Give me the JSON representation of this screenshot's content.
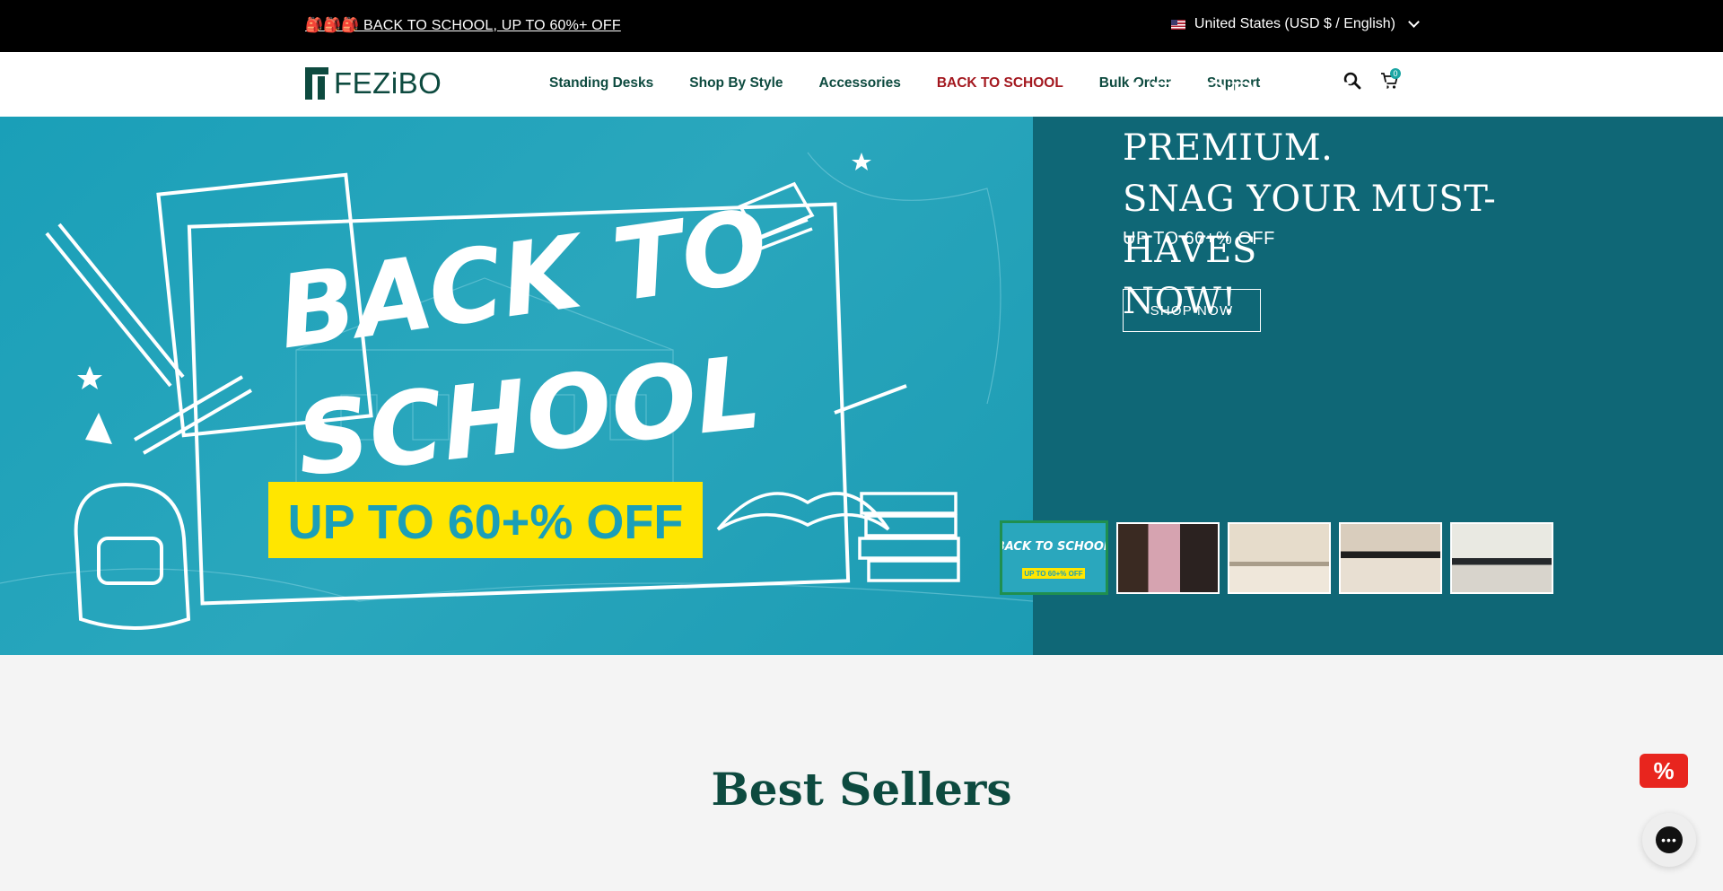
{
  "announcement": {
    "promo_text": "🎒🎒🎒 BACK TO SCHOOL, UP TO 60%+ OFF",
    "region_text": "United States (USD $ / English)"
  },
  "header": {
    "logo_text": "FEZiBO",
    "nav": [
      {
        "label": "Standing Desks"
      },
      {
        "label": "Shop By Style"
      },
      {
        "label": "Accessories"
      },
      {
        "label": "BACK TO SCHOOL"
      },
      {
        "label": "Bulk Order"
      },
      {
        "label": "Support"
      }
    ],
    "cart_count": "0"
  },
  "hero": {
    "banner_title_line1": "BACK TO",
    "banner_title_line2": "SCHOOL",
    "banner_offer": "UP TO 60+% OFF",
    "title_line1": "AFFORDABLE & PREMIUM.",
    "title_line2": "SNAG YOUR MUST-HAVES",
    "title_line3": "NOW!",
    "subtitle": "UP TO 60+% OFF",
    "cta_label": "SHOP NOW",
    "thumb1_title": "BACK TO SCHOOL",
    "thumb1_offer": "UP TO 60+% OFF"
  },
  "sections": {
    "best_sellers_title": "Best Sellers"
  },
  "widgets": {
    "discount_symbol": "%"
  },
  "colors": {
    "brand_green": "#0d4a3f",
    "hero_teal": "#0f6776",
    "banner_teal": "#2aa7bd",
    "sale_red": "#a3171e",
    "offer_yellow": "#ffe600"
  },
  "icons": [
    "us-flag-icon",
    "chevron-down-icon",
    "search-icon",
    "cart-icon",
    "percent-badge-icon",
    "chat-icon"
  ]
}
